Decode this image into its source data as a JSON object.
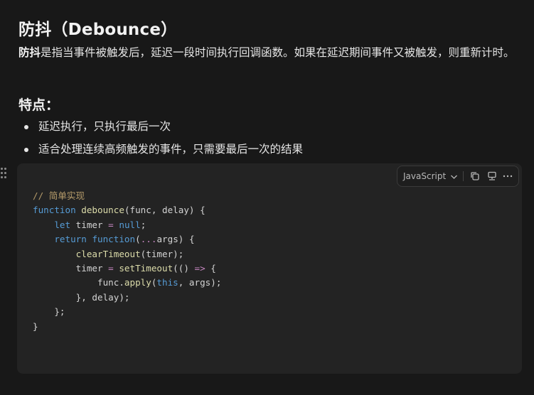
{
  "doc": {
    "title": "防抖（Debounce）",
    "description_strong": "防抖",
    "description_rest": "是指当事件被触发后，延迟一段时间执行回调函数。如果在延迟期间事件又被触发，则重新计时。",
    "features_heading": "特点：",
    "features": [
      "延迟执行，只执行最后一次",
      "适合处理连续高频触发的事件，只需要最后一次的结果"
    ]
  },
  "code_block": {
    "language": "JavaScript",
    "icons": {
      "language_dropdown": "chevron-down-icon",
      "copy": "copy-icon",
      "preview": "preview-icon",
      "more": "more-icon"
    },
    "lines": [
      [
        {
          "t": "// 简单实现",
          "c": "comment"
        }
      ],
      [
        {
          "t": "function",
          "c": "kw"
        },
        {
          "t": " ",
          "c": "punc"
        },
        {
          "t": "debounce",
          "c": "fn"
        },
        {
          "t": "(func, delay) {",
          "c": "punc"
        }
      ],
      [
        {
          "t": "    ",
          "c": "punc"
        },
        {
          "t": "let",
          "c": "kw"
        },
        {
          "t": " timer ",
          "c": "var"
        },
        {
          "t": "=",
          "c": "op"
        },
        {
          "t": " ",
          "c": "punc"
        },
        {
          "t": "null",
          "c": "null"
        },
        {
          "t": ";",
          "c": "punc"
        }
      ],
      [
        {
          "t": "    ",
          "c": "punc"
        },
        {
          "t": "return",
          "c": "kw"
        },
        {
          "t": " ",
          "c": "punc"
        },
        {
          "t": "function",
          "c": "kw"
        },
        {
          "t": "(",
          "c": "punc"
        },
        {
          "t": "...",
          "c": "op"
        },
        {
          "t": "args) {",
          "c": "punc"
        }
      ],
      [
        {
          "t": "        ",
          "c": "punc"
        },
        {
          "t": "clearTimeout",
          "c": "fn"
        },
        {
          "t": "(timer);",
          "c": "punc"
        }
      ],
      [
        {
          "t": "        timer ",
          "c": "var"
        },
        {
          "t": "=",
          "c": "op"
        },
        {
          "t": " ",
          "c": "punc"
        },
        {
          "t": "setTimeout",
          "c": "fn"
        },
        {
          "t": "(() ",
          "c": "punc"
        },
        {
          "t": "=>",
          "c": "op"
        },
        {
          "t": " {",
          "c": "punc"
        }
      ],
      [
        {
          "t": "            func.",
          "c": "var"
        },
        {
          "t": "apply",
          "c": "fn"
        },
        {
          "t": "(",
          "c": "punc"
        },
        {
          "t": "this",
          "c": "this"
        },
        {
          "t": ", args);",
          "c": "punc"
        }
      ],
      [
        {
          "t": "        }, delay);",
          "c": "punc"
        }
      ],
      [
        {
          "t": "    };",
          "c": "punc"
        }
      ],
      [
        {
          "t": "}",
          "c": "punc"
        }
      ]
    ]
  }
}
